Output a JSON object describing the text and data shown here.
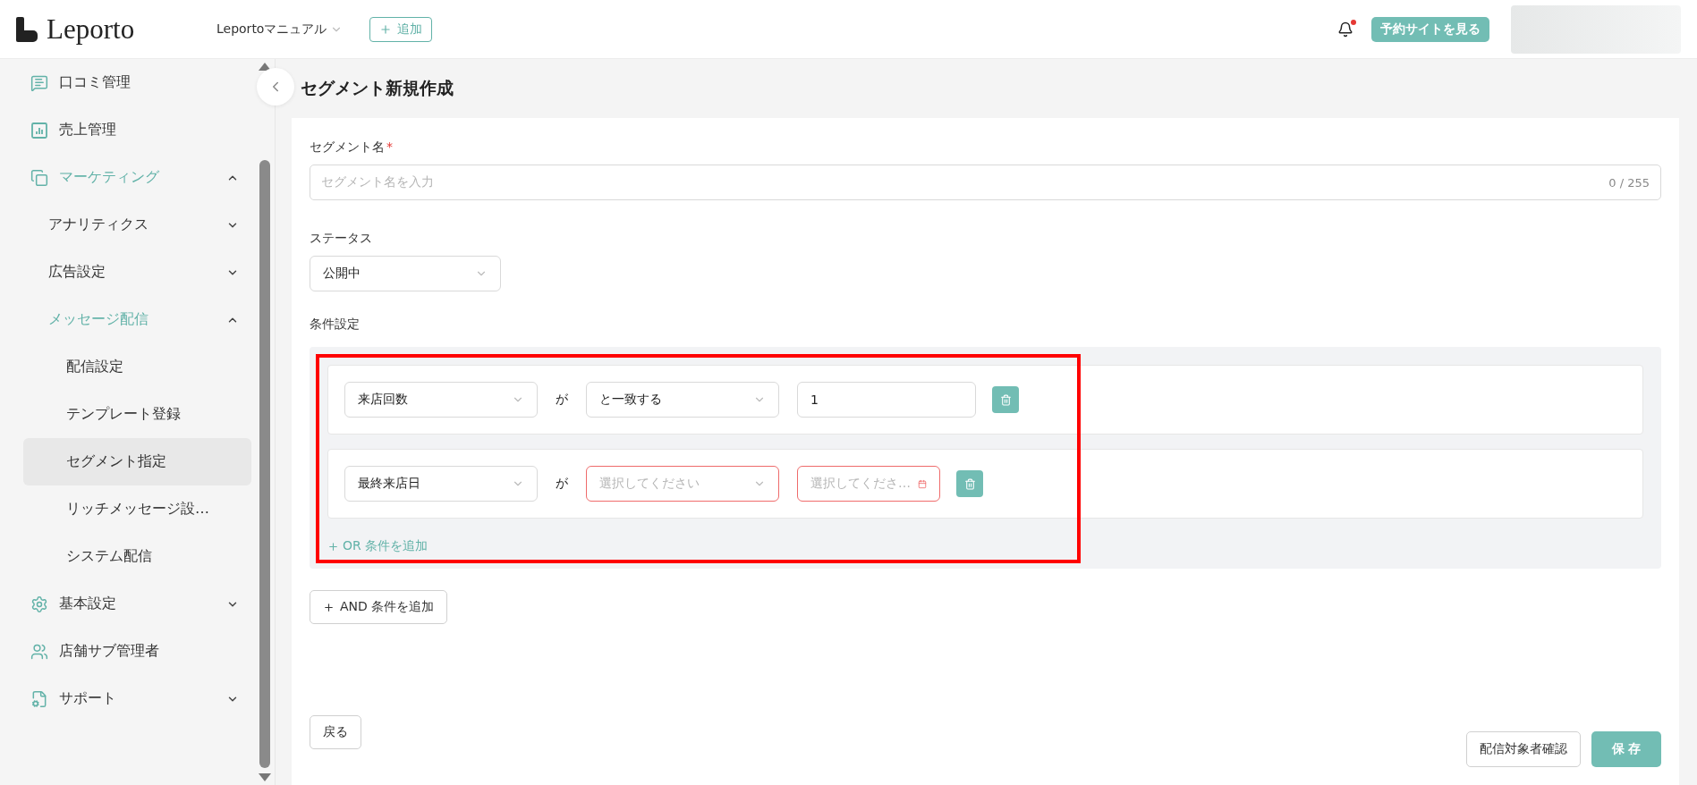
{
  "header": {
    "logo": "Leporto",
    "workspace": "Leportoマニュアル",
    "add_button": "追加",
    "notification": {
      "unread": true
    },
    "site_button": "予約サイトを見る"
  },
  "sidebar": {
    "items": [
      {
        "label": "口コミ管理",
        "kind": "comment",
        "selected": false
      },
      {
        "label": "売上管理",
        "kind": "chart",
        "selected": false
      },
      {
        "label": "マーケティング",
        "kind": "window",
        "selected": false,
        "expanded": true,
        "children": [
          {
            "label": "アナリティクス",
            "selected": false,
            "expanded": false
          },
          {
            "label": "広告設定",
            "selected": false,
            "expanded": false
          },
          {
            "label": "メッセージ配信",
            "selected": false,
            "expanded": true,
            "children": [
              {
                "label": "配信設定",
                "selected": false
              },
              {
                "label": "テンプレート登録",
                "selected": false
              },
              {
                "label": "セグメント指定",
                "selected": true
              },
              {
                "label": "リッチメッセージ設…",
                "selected": false
              },
              {
                "label": "システム配信",
                "selected": false
              }
            ]
          }
        ]
      },
      {
        "label": "基本設定",
        "kind": "gear",
        "selected": false,
        "expanded": false
      },
      {
        "label": "店舗サブ管理者",
        "kind": "users",
        "selected": false
      },
      {
        "label": "サポート",
        "kind": "document",
        "selected": false,
        "expanded": false
      }
    ]
  },
  "page": {
    "title": "セグメント新規作成",
    "segment_name": {
      "label": "セグメント名",
      "required_mark": "*",
      "placeholder": "セグメント名を入力",
      "counter": "0 / 255"
    },
    "status": {
      "label": "ステータス",
      "value": "公開中"
    },
    "conditions": {
      "label": "条件設定",
      "rows": [
        {
          "field": "来店回数",
          "connector": "が",
          "operator": {
            "value": "と一致する",
            "error": false
          },
          "target": {
            "kind": "text",
            "value": "1",
            "error": false
          }
        },
        {
          "field": "最終来店日",
          "connector": "が",
          "operator": {
            "placeholder": "選択してください",
            "error": true
          },
          "target": {
            "kind": "date",
            "placeholder": "選択してくださ…",
            "error": true
          }
        }
      ],
      "or_button": "OR 条件を追加"
    },
    "and_button": "AND 条件を追加",
    "back_button": "戻る",
    "confirm_button": "配信対象者確認",
    "save_button": "保 存"
  }
}
